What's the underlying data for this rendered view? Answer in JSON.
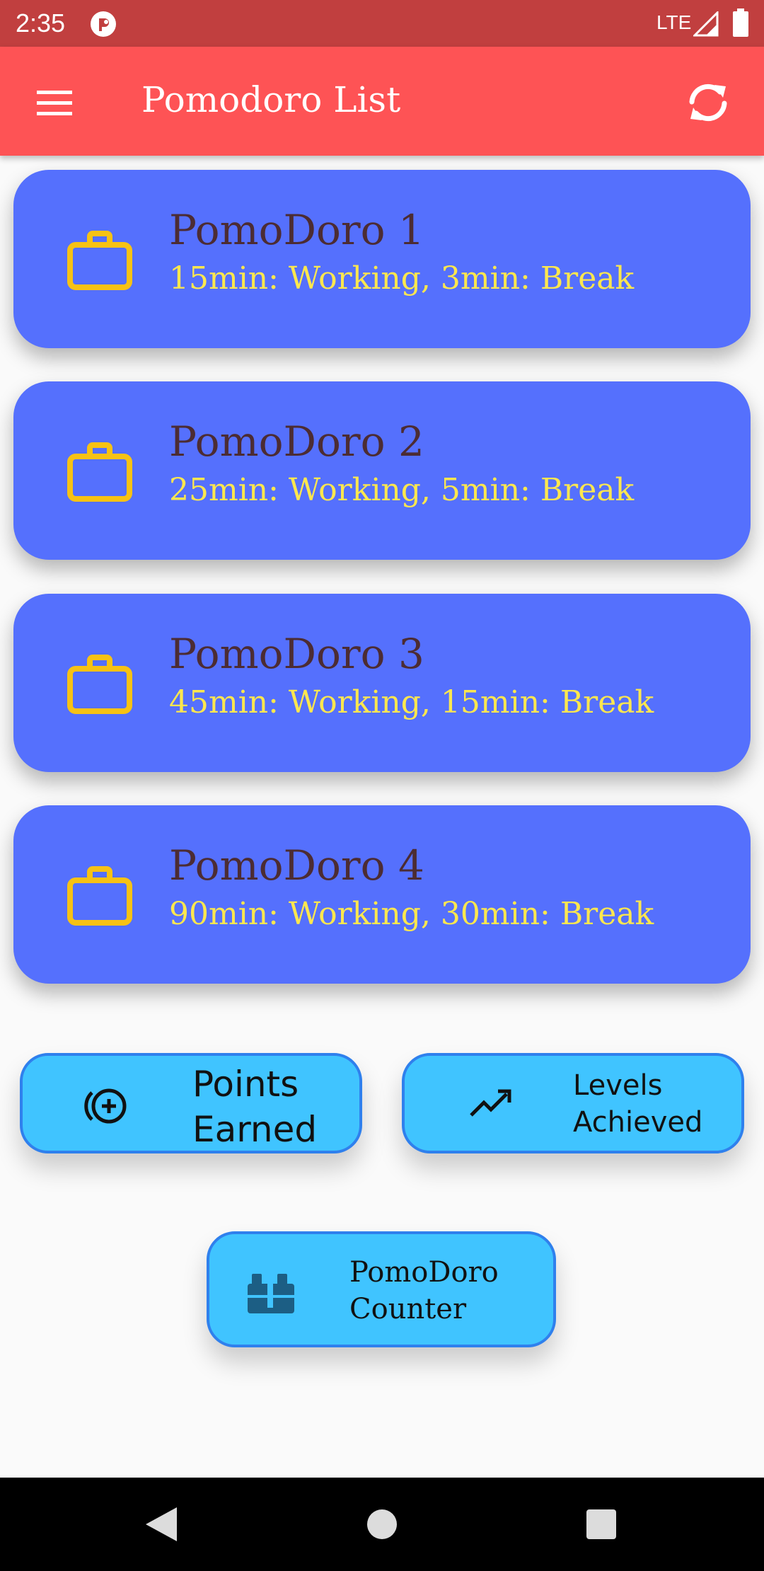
{
  "status_bar": {
    "time": "2:35",
    "network": "LTE",
    "app_icon": "app-notification-icon",
    "signal_icon": "signal-icon",
    "battery_icon": "battery-icon"
  },
  "app_bar": {
    "title": "Pomodoro List",
    "menu_icon": "hamburger-menu-icon",
    "sync_icon": "sync-icon",
    "background": "#fe5355"
  },
  "pomodoros": [
    {
      "title": "PomoDoro 1",
      "subtitle": "15min: Working, 3min: Break",
      "icon": "briefcase-icon"
    },
    {
      "title": "PomoDoro 2",
      "subtitle": "25min: Working, 5min: Break",
      "icon": "briefcase-icon"
    },
    {
      "title": "PomoDoro 3",
      "subtitle": "45min: Working, 15min: Break",
      "icon": "briefcase-icon"
    },
    {
      "title": "PomoDoro 4",
      "subtitle": "90min: Working, 30min: Break",
      "icon": "briefcase-icon"
    }
  ],
  "actions": {
    "points": {
      "line1": "Points",
      "line2": "Earned",
      "icon": "add-circle-icon"
    },
    "levels": {
      "line1": "Levels",
      "line2": "Achieved",
      "icon": "trending-up-icon"
    },
    "counter": {
      "line1": "PomoDoro",
      "line2": "Counter",
      "icon": "toolbox-icon"
    }
  },
  "colors": {
    "card_background": "#5570fd",
    "card_title": "#4c2c33",
    "card_subtitle": "#fde74e",
    "briefcase": "#f7c214",
    "button_background": "#40c4ff",
    "button_border": "#2f80ed",
    "status_bar": "#c13f3f"
  },
  "nav_bar": {
    "back_icon": "back-triangle-icon",
    "home_icon": "home-circle-icon",
    "recents_icon": "recents-square-icon"
  }
}
